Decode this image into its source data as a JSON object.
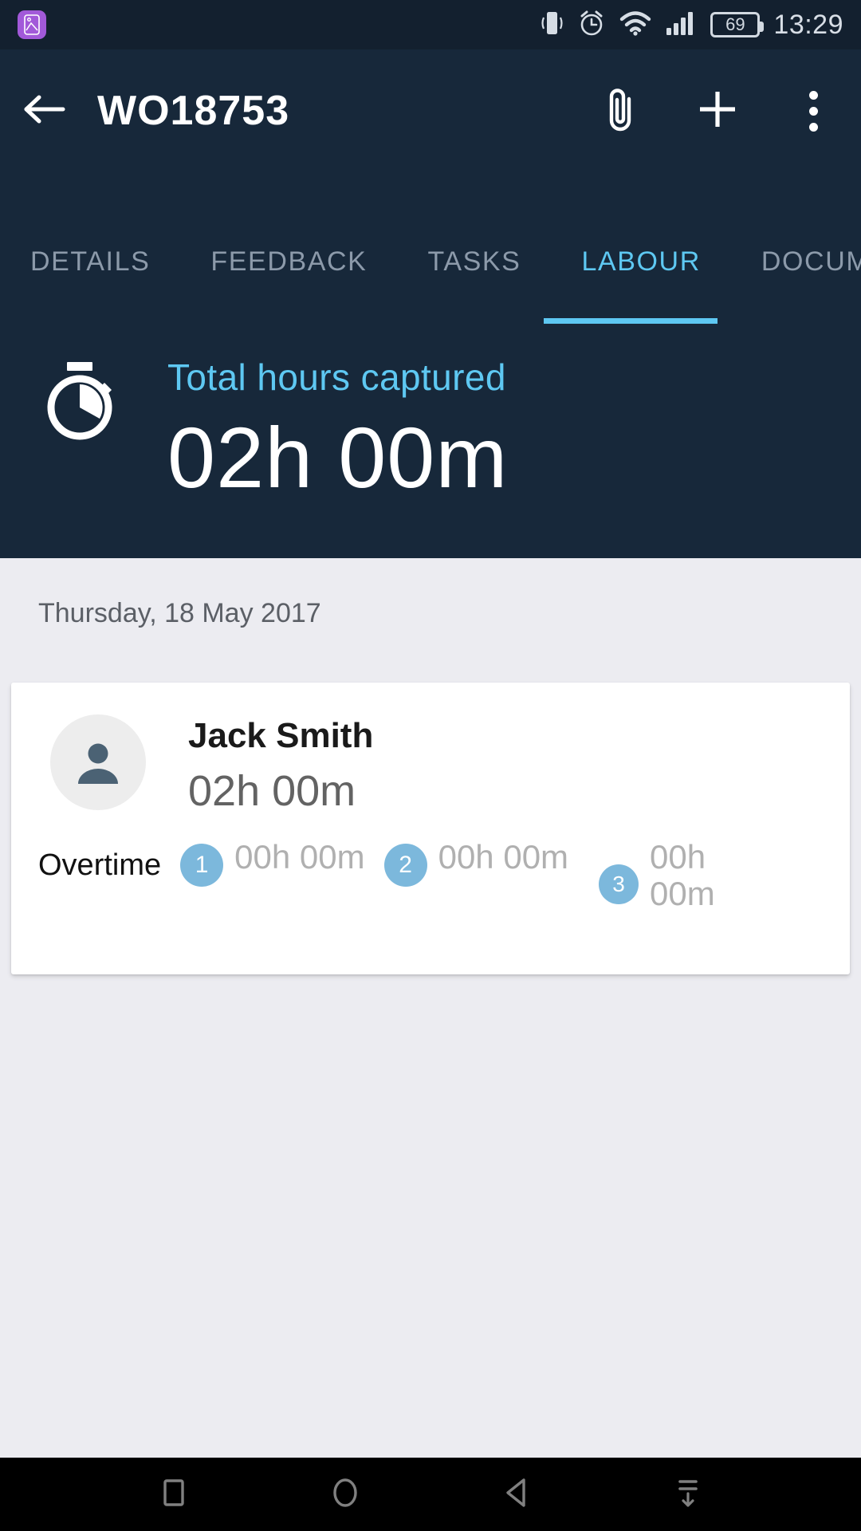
{
  "status_bar": {
    "app_icon": "gallery-app-icon",
    "icons": [
      "vibrate-icon",
      "alarm-icon",
      "wifi-icon",
      "signal-icon"
    ],
    "battery_level": "69",
    "time": "13:29"
  },
  "app_bar": {
    "back_label": "back-arrow",
    "title": "WO18753",
    "actions": [
      {
        "name": "attach",
        "icon": "paperclip-icon"
      },
      {
        "name": "add",
        "icon": "plus-icon"
      },
      {
        "name": "more",
        "icon": "overflow-menu-icon"
      }
    ]
  },
  "tabs": {
    "items": [
      {
        "label": "DETAILS",
        "active": false
      },
      {
        "label": "FEEDBACK",
        "active": false
      },
      {
        "label": "TASKS",
        "active": false
      },
      {
        "label": "LABOUR",
        "active": true
      },
      {
        "label": "DOCUME",
        "active": false
      }
    ],
    "active_index": 3,
    "active_color": "#5EC8F2",
    "inactive_color": "#8C9AAA"
  },
  "summary": {
    "icon": "stopwatch-icon",
    "label": "Total hours captured",
    "value": "02h 00m"
  },
  "body": {
    "date_header": "Thursday, 18 May 2017",
    "card": {
      "avatar_icon": "person-avatar-icon",
      "name": "Jack Smith",
      "hours": "02h 00m",
      "overtime_label": "Overtime",
      "overtime_entries": [
        {
          "badge": "1",
          "value": "00h 00m"
        },
        {
          "badge": "2",
          "value": "00h 00m"
        },
        {
          "badge": "3",
          "value": "00h 00m"
        }
      ],
      "badge_color": "#7CB8DC"
    }
  },
  "nav_bar": {
    "buttons": [
      {
        "name": "recents-button",
        "icon": "square-icon"
      },
      {
        "name": "home-button",
        "icon": "circle-icon"
      },
      {
        "name": "back-button",
        "icon": "triangle-left-icon"
      },
      {
        "name": "hide-navbar-button",
        "icon": "collapse-down-icon"
      }
    ]
  },
  "colors": {
    "status_bar_bg": "#13202F",
    "app_bar_bg": "#17283A",
    "body_bg": "#ECECF1",
    "accent": "#5EC8F2"
  }
}
